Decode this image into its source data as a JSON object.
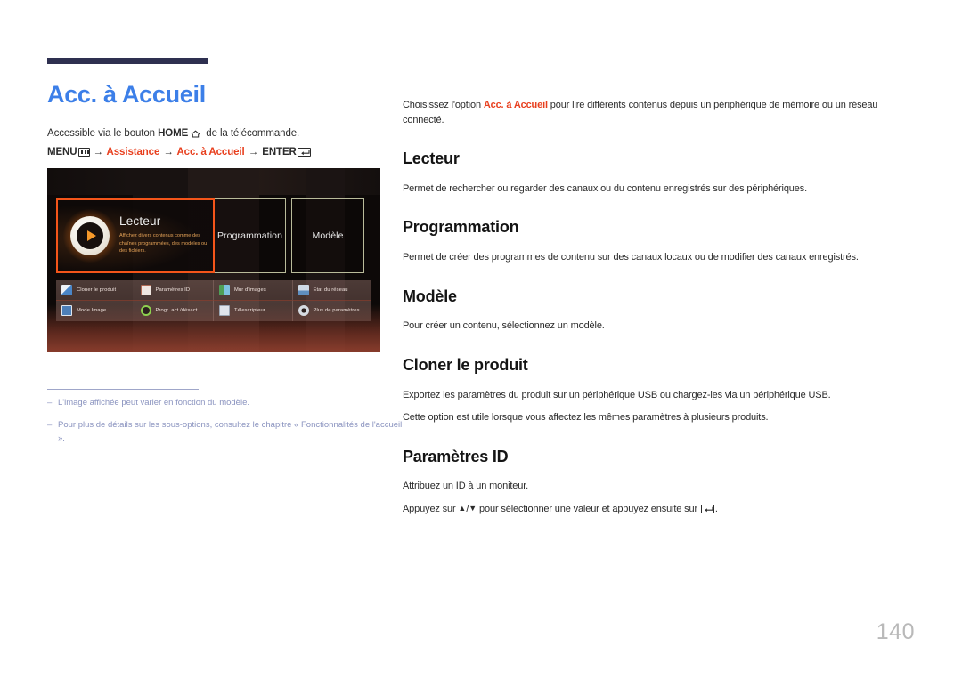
{
  "document": {
    "page_number": "140",
    "title": "Acc. à Accueil",
    "title_color": "#3c7fe8",
    "accent_red": "#e8401f",
    "header_bar_color": "#2e3050"
  },
  "left": {
    "access_prefix": "Accessible via le bouton ",
    "access_home_label": "HOME",
    "access_suffix": " de la télécommande.",
    "menu_path": {
      "menu_label": "MENU",
      "step1": "Assistance",
      "step2": "Acc. à Accueil",
      "enter_label": "ENTER",
      "arrow": "→"
    },
    "notes": [
      {
        "dash": "‒",
        "text": "L'image affichée peut varier en fonction du modèle."
      },
      {
        "dash": "‒",
        "text": "Pour plus de détails sur les sous-options, consultez le chapitre « Fonctionnalités de l'accueil »."
      }
    ]
  },
  "tv_screenshot": {
    "tiles": [
      {
        "name": "Lecteur",
        "description": "Affichez divers contenus comme des chaînes programmées, des modèles ou des fichiers.",
        "selected": true
      },
      {
        "name": "Programmation",
        "description": "",
        "selected": false
      },
      {
        "name": "Modèle",
        "description": "",
        "selected": false
      }
    ],
    "icon_grid": [
      {
        "label": "Cloner le produit",
        "icon": "clone-product-icon",
        "color": "#d8e2ef"
      },
      {
        "label": "Paramètres ID",
        "icon": "id-settings-icon",
        "color": "#e2d3cc"
      },
      {
        "label": "Mur d'images",
        "icon": "video-wall-icon",
        "color": "#3f8f4e"
      },
      {
        "label": "État du réseau",
        "icon": "network-status-icon",
        "color": "#5a8fc4"
      },
      {
        "label": "Mode Image",
        "icon": "picture-mode-icon",
        "color": "#4d7fb8"
      },
      {
        "label": "Progr. act./désact.",
        "icon": "on-off-timer-icon",
        "color": "#7bc44f"
      },
      {
        "label": "Télescripteur",
        "icon": "ticker-icon",
        "color": "#cfd7e0"
      },
      {
        "label": "Plus de paramètres",
        "icon": "more-settings-icon",
        "color": "#cfd4da"
      }
    ]
  },
  "right": {
    "intro": {
      "before": "Choisissez l'option ",
      "highlight": "Acc. à Accueil",
      "after": " pour lire différents contenus depuis un périphérique de mémoire ou un réseau connecté."
    },
    "sections": [
      {
        "heading": "Lecteur",
        "paragraphs": [
          "Permet de rechercher ou regarder des canaux ou du contenu enregistrés sur des périphériques."
        ]
      },
      {
        "heading": "Programmation",
        "paragraphs": [
          "Permet de créer des programmes de contenu sur des canaux locaux ou de modifier des canaux enregistrés."
        ]
      },
      {
        "heading": "Modèle",
        "paragraphs": [
          "Pour créer un contenu, sélectionnez un modèle."
        ]
      },
      {
        "heading": "Cloner le produit",
        "paragraphs": [
          "Exportez les paramètres du produit sur un périphérique USB ou chargez-les via un périphérique USB.",
          "Cette option est utile lorsque vous affectez les mêmes paramètres à plusieurs produits."
        ]
      },
      {
        "heading": "Paramètres ID",
        "paragraphs": [
          "Attribuez un ID à un moniteur."
        ],
        "key_line": {
          "before": "Appuyez sur ",
          "up": "▲",
          "sep": "/",
          "down": "▼",
          "middle": " pour sélectionner une valeur et appuyez ensuite sur ",
          "after": "."
        }
      }
    ]
  }
}
